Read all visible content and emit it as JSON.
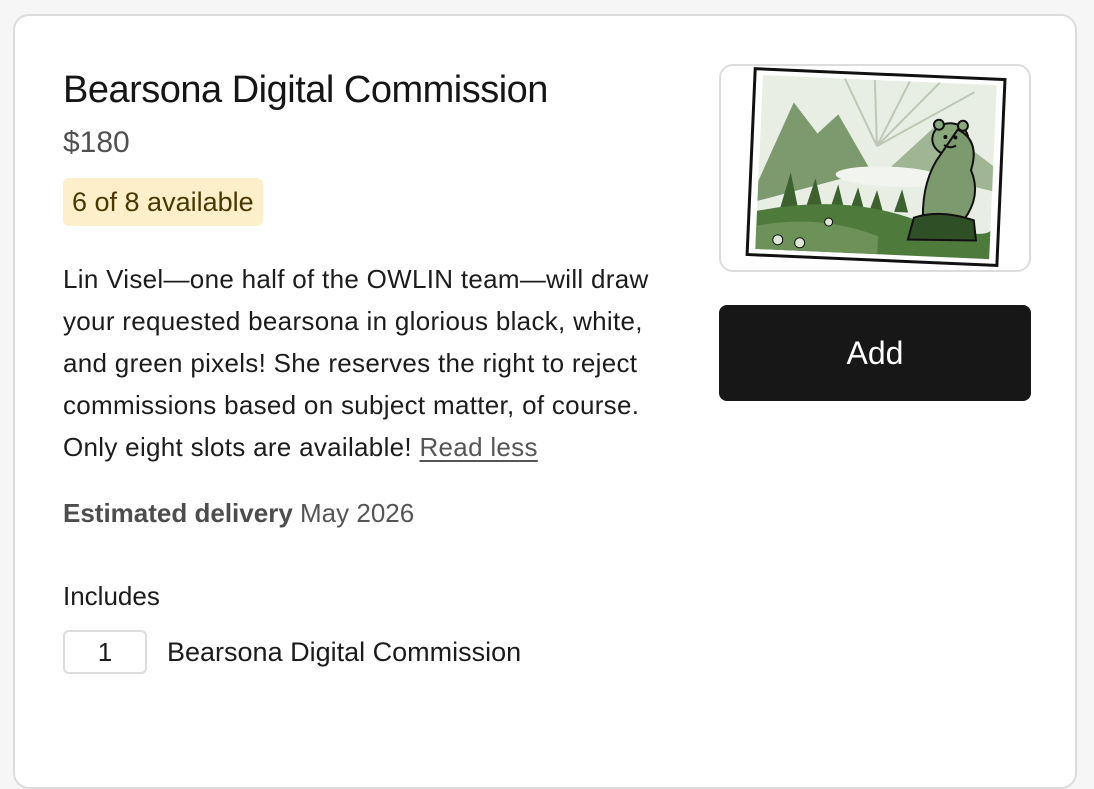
{
  "product": {
    "title": "Bearsona Digital Commission",
    "price": "$180",
    "availability": "6 of 8 available",
    "description": "Lin Visel—one half of the OWLIN team—will draw your requested bearsona in glorious black, white, and green pixels! She reserves the right to reject commissions based on subject matter, of course. Only eight slots are available!",
    "read_less_label": "Read less",
    "delivery_label": "Estimated delivery",
    "delivery_value": "May 2026",
    "image_icon": "bearsona-illustration",
    "add_label": "Add"
  },
  "includes": {
    "heading": "Includes",
    "items": [
      {
        "quantity": "1",
        "name": "Bearsona Digital Commission"
      }
    ]
  },
  "colors": {
    "badge_bg": "#fcefc9",
    "button_bg": "#171717",
    "illustration_green": "#4e7a3c"
  }
}
